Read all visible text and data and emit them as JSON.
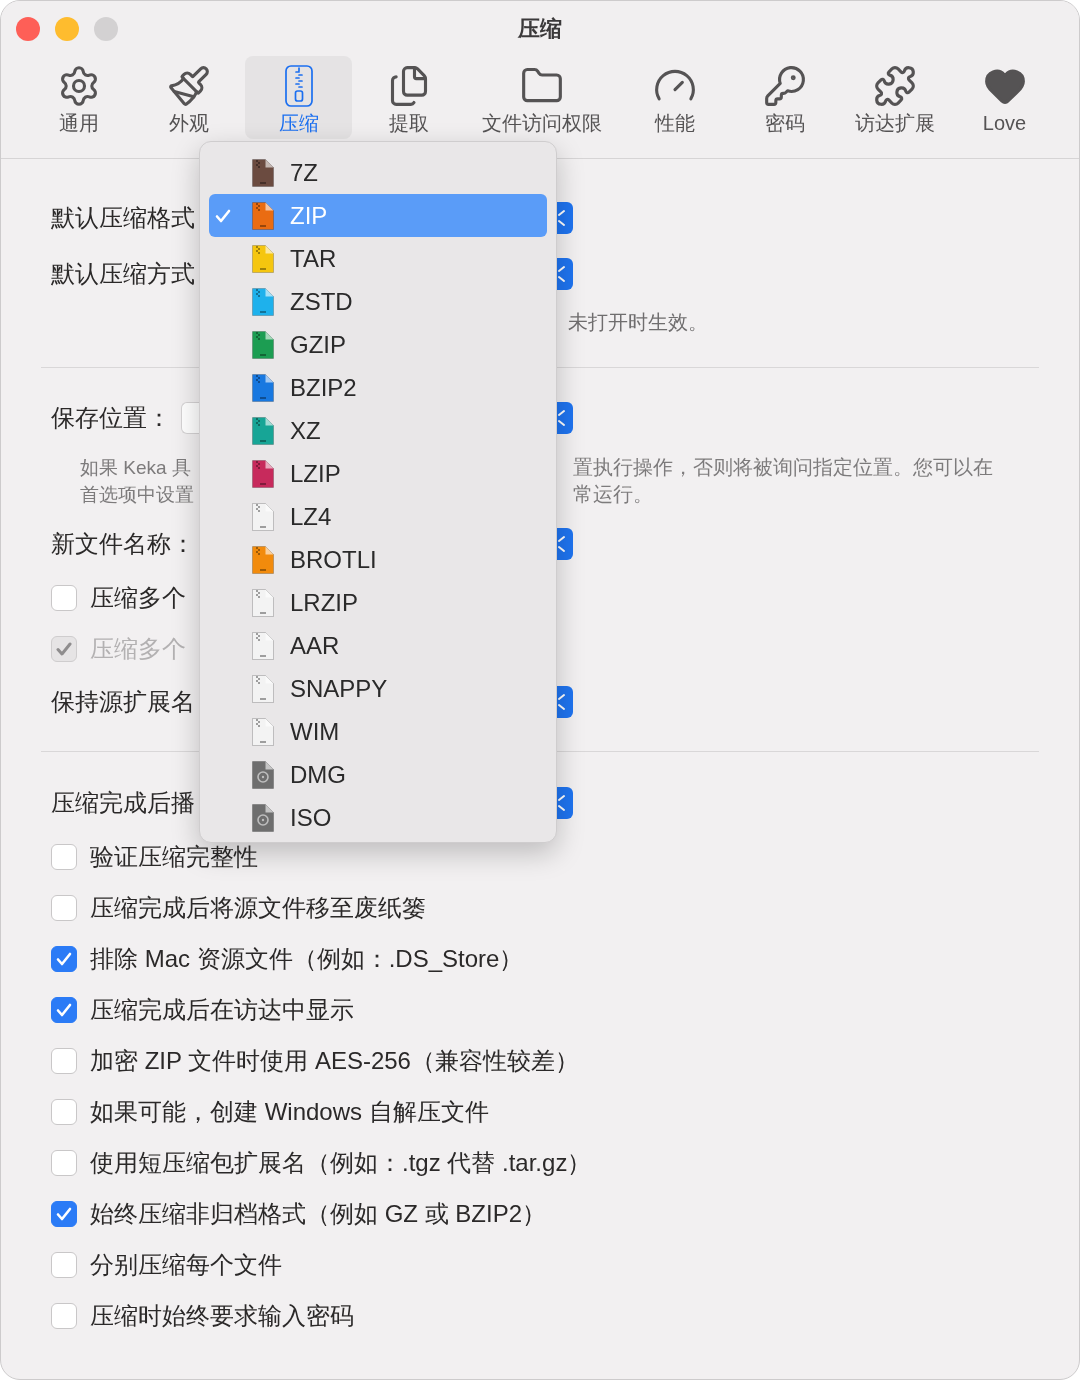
{
  "window": {
    "title": "压缩",
    "buttons": [
      {
        "color": "#fe5f57"
      },
      {
        "color": "#febc2e"
      },
      {
        "color": "#d3d1d2"
      }
    ]
  },
  "toolbar": {
    "tabs": [
      {
        "label": "通用",
        "selected": false
      },
      {
        "label": "外观",
        "selected": false
      },
      {
        "label": "压缩",
        "selected": true
      },
      {
        "label": "提取",
        "selected": false
      },
      {
        "label": "文件访问权限",
        "selected": false
      },
      {
        "label": "性能",
        "selected": false
      },
      {
        "label": "密码",
        "selected": false
      },
      {
        "label": "访达扩展",
        "selected": false
      },
      {
        "label": "Love",
        "selected": false
      }
    ]
  },
  "sections": [
    {
      "rows": [
        {
          "kind": "popup",
          "label": "默认压缩格式"
        },
        {
          "kind": "popup",
          "label": "默认压缩方式"
        },
        {
          "kind": "note",
          "text": "未打开时生效。"
        }
      ]
    },
    {
      "rows": [
        {
          "kind": "location",
          "label": "保存位置："
        },
        {
          "kind": "help",
          "left_lines": [
            "如果 Keka 具",
            "首选项中设置"
          ],
          "right_lines": [
            "置执行操作，否则将被询问指定位置。您可以在",
            "常运行。"
          ]
        },
        {
          "kind": "popup",
          "label": "新文件名称："
        },
        {
          "kind": "checkbox",
          "label": "压缩多个",
          "checked": false,
          "disabled": false
        },
        {
          "kind": "checkbox",
          "label": "压缩多个",
          "checked": true,
          "disabled": true
        },
        {
          "kind": "popup",
          "label": "保持源扩展名"
        }
      ]
    },
    {
      "rows": [
        {
          "kind": "popup",
          "label": "压缩完成后播"
        },
        {
          "kind": "checkbox",
          "label": "验证压缩完整性",
          "checked": false,
          "disabled": false
        },
        {
          "kind": "checkbox",
          "label": "压缩完成后将源文件移至废纸篓",
          "checked": false,
          "disabled": false
        },
        {
          "kind": "checkbox",
          "label": "排除 Mac 资源文件（例如：.DS_Store）",
          "checked": true,
          "disabled": false
        },
        {
          "kind": "checkbox",
          "label": "压缩完成后在访达中显示",
          "checked": true,
          "disabled": false
        },
        {
          "kind": "checkbox",
          "label": "加密 ZIP 文件时使用 AES-256（兼容性较差）",
          "checked": false,
          "disabled": false
        },
        {
          "kind": "checkbox",
          "label": "如果可能，创建 Windows 自解压文件",
          "checked": false,
          "disabled": false
        },
        {
          "kind": "checkbox",
          "label": "使用短压缩包扩展名（例如：.tgz 代替 .tar.gz）",
          "checked": false,
          "disabled": false
        },
        {
          "kind": "checkbox",
          "label": "始终压缩非归档格式（例如 GZ 或 BZIP2）",
          "checked": true,
          "disabled": false
        },
        {
          "kind": "checkbox",
          "label": "分别压缩每个文件",
          "checked": false,
          "disabled": false
        },
        {
          "kind": "checkbox",
          "label": "压缩时始终要求输入密码",
          "checked": false,
          "disabled": false
        }
      ]
    }
  ],
  "format_menu": {
    "items": [
      {
        "label": "7Z",
        "kind": "archive",
        "color": "#6b4b40",
        "selected": false
      },
      {
        "label": "ZIP",
        "kind": "archive",
        "color": "#ea6c12",
        "selected": true
      },
      {
        "label": "TAR",
        "kind": "archive",
        "color": "#f5c60f",
        "selected": false
      },
      {
        "label": "ZSTD",
        "kind": "archive",
        "color": "#1eb1ec",
        "selected": false
      },
      {
        "label": "GZIP",
        "kind": "archive",
        "color": "#1c9d52",
        "selected": false
      },
      {
        "label": "BZIP2",
        "kind": "archive",
        "color": "#1878e0",
        "selected": false
      },
      {
        "label": "XZ",
        "kind": "archive",
        "color": "#17a596",
        "selected": false
      },
      {
        "label": "LZIP",
        "kind": "archive",
        "color": "#c72a5c",
        "selected": false
      },
      {
        "label": "LZ4",
        "kind": "archive",
        "color": "#f3f3f3",
        "selected": false
      },
      {
        "label": "BROTLI",
        "kind": "archive",
        "color": "#f28b0c",
        "selected": false
      },
      {
        "label": "LRZIP",
        "kind": "archive",
        "color": "#f3f3f3",
        "selected": false
      },
      {
        "label": "AAR",
        "kind": "archive",
        "color": "#f3f3f3",
        "selected": false
      },
      {
        "label": "SNAPPY",
        "kind": "archive",
        "color": "#f3f3f3",
        "selected": false
      },
      {
        "label": "WIM",
        "kind": "archive",
        "color": "#f3f3f3",
        "selected": false
      },
      {
        "label": "DMG",
        "kind": "disk",
        "color": "#6e6e6e",
        "selected": false
      },
      {
        "label": "ISO",
        "kind": "disk",
        "color": "#6e6e6e",
        "selected": false
      }
    ]
  }
}
